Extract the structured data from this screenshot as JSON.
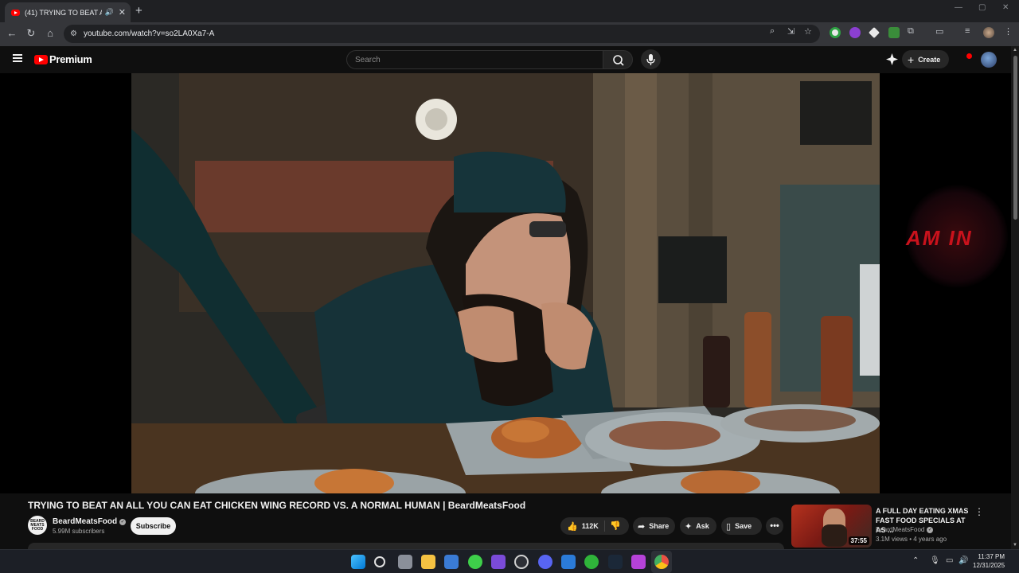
{
  "browser": {
    "tab_title": "(41) TRYING TO BEAT AN A",
    "url": "youtube.com/watch?v=so2LA0Xa7-A",
    "new_tab": "+",
    "tab_close": "✕",
    "window_controls": [
      "—",
      "▢",
      "✕"
    ]
  },
  "youtube": {
    "logo_text": "Premium",
    "search_placeholder": "Search",
    "create_label": "Create",
    "notification_color": "#ff0000"
  },
  "overlay": {
    "text": "AM IN"
  },
  "video": {
    "title": "TRYING TO BEAT AN ALL YOU CAN EAT CHICKEN WING RECORD VS. A NORMAL HUMAN | BeardMeatsFood",
    "channel": "BeardMeatsFood",
    "channel_avatar_text": "BEARD MEATS FOOD",
    "subscribers": "5.99M subscribers",
    "subscribe_label": "Subscribe",
    "likes": "112K",
    "share_label": "Share",
    "ask_label": "Ask",
    "save_label": "Save",
    "more_label": "•••"
  },
  "recommended": [
    {
      "title": "A FULL DAY EATING XMAS FAST FOOD SPECIALS AT AS ...",
      "channel": "BeardMeatsFood",
      "meta": "3.1M views • 4 years ago",
      "duration": "37:55"
    }
  ],
  "taskbar": {
    "time": "11:37 PM",
    "date": "12/31/2025",
    "icons": [
      "windows-start-icon",
      "search-icon",
      "task-view-icon",
      "file-explorer-icon",
      "store-icon",
      "app-green-icon",
      "app-purple-icon",
      "github-icon",
      "discord-icon",
      "mail-icon",
      "xbox-icon",
      "steam-icon",
      "app-media-icon",
      "chrome-icon"
    ]
  }
}
